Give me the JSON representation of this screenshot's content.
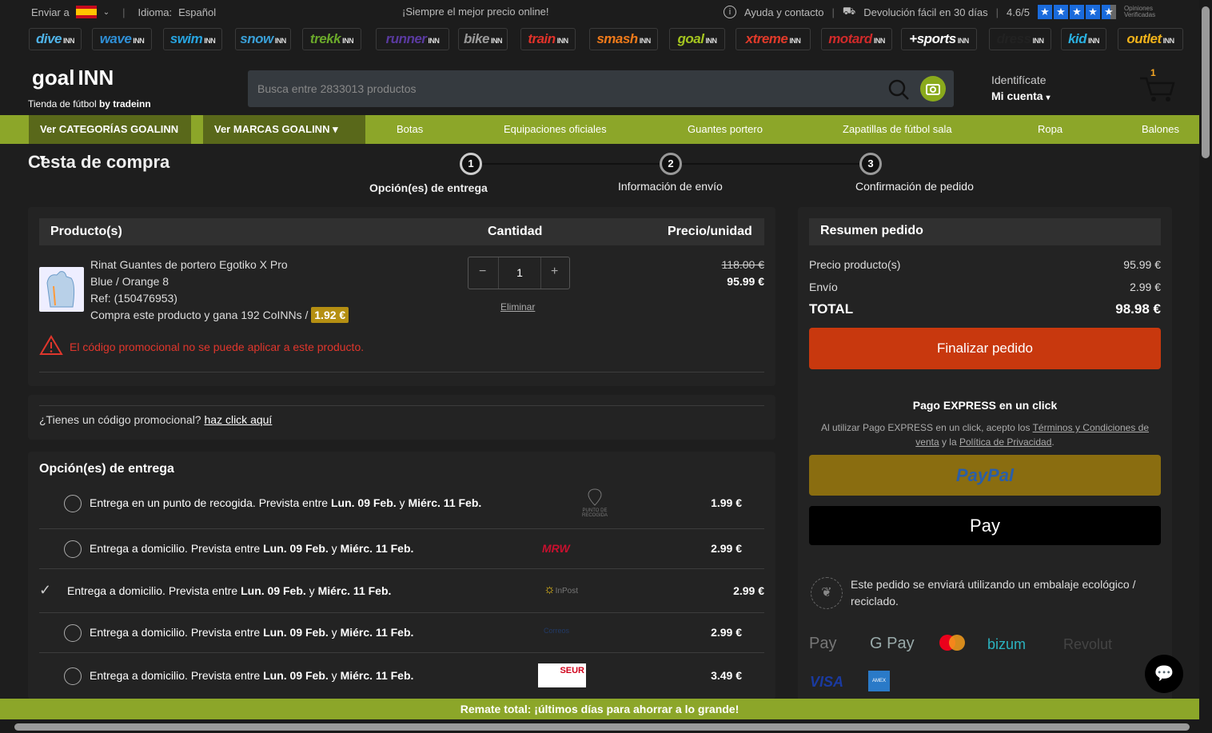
{
  "topbar": {
    "ship_label": "Enviar a",
    "lang_label": "Idioma:",
    "lang_value": "Español",
    "promo": "¡Siempre el mejor precio online!",
    "help": "Ayuda y contacto",
    "returns": "Devolución fácil en 30 días",
    "rating": "4.6/5",
    "verified": "Opiniones Verificadas"
  },
  "brands": [
    {
      "name": "dive",
      "color": "#4fb3e8"
    },
    {
      "name": "wave",
      "color": "#2f8fd6"
    },
    {
      "name": "swim",
      "color": "#27a4e0"
    },
    {
      "name": "snow",
      "color": "#3aa0d8"
    },
    {
      "name": "trekk",
      "color": "#6aa82a"
    },
    {
      "name": "runner",
      "color": "#5a3aa0"
    },
    {
      "name": "bike",
      "color": "#9a9a9a"
    },
    {
      "name": "train",
      "color": "#e0322a"
    },
    {
      "name": "smash",
      "color": "#ef7a1a"
    },
    {
      "name": "goal",
      "color": "#a4c51f"
    },
    {
      "name": "xtreme",
      "color": "#e03a2a"
    },
    {
      "name": "motard",
      "color": "#d02a2a"
    },
    {
      "name": "+sports",
      "color": "#ffffff"
    },
    {
      "name": "dress",
      "color": "#222222"
    },
    {
      "name": "kid",
      "color": "#2ab0e0"
    },
    {
      "name": "outlet",
      "color": "#f0b21a"
    }
  ],
  "brand_suffix": "INN",
  "header": {
    "logo": "goal",
    "logo_suffix": "INN",
    "tagline": "Tienda de fútbol",
    "by": "by tradeinn",
    "search_placeholder": "Busca entre 2833013 productos",
    "login": "Identifícate",
    "account": "Mi cuenta",
    "cart_count": "1"
  },
  "nav": {
    "categories": "Ver CATEGORÍAS GOALINN",
    "brands": "Ver MARCAS GOALINN",
    "links": [
      "Botas",
      "Equipaciones oficiales",
      "Guantes portero",
      "Zapatillas de fútbol sala",
      "Ropa",
      "Balones"
    ]
  },
  "page_title": "Cesta de compra",
  "steps": [
    {
      "num": "1",
      "label": "Opción(es) de entrega"
    },
    {
      "num": "2",
      "label": "Información de envío"
    },
    {
      "num": "3",
      "label": "Confirmación de pedido"
    }
  ],
  "cart": {
    "col_product": "Producto(s)",
    "col_qty": "Cantidad",
    "col_price": "Precio/unidad",
    "product_name": "Rinat Guantes de portero Egotiko X Pro",
    "variant": "Blue / Orange 8",
    "ref": "Ref: (150476953)",
    "coins": "Compra este producto y gana 192 CoINNs /",
    "coins_value": "1.92 €",
    "qty": "1",
    "remove": "Eliminar",
    "old_price": "118.00 €",
    "price": "95.99 €",
    "promo_warning": "El código promocional no se puede aplicar a este producto."
  },
  "promo": {
    "question": "¿Tienes un código promocional?",
    "link": "haz click aquí"
  },
  "delivery": {
    "title": "Opción(es) de entrega",
    "options": [
      {
        "text": "Entrega en un punto de recogida. Prevista entre ",
        "d1": "Lun. 09 Feb.",
        "mid": " y ",
        "d2": "Miérc. 11 Feb.",
        "carrier": "PUNTO DE RECOGIDA",
        "price": "1.99 €"
      },
      {
        "text": "Entrega a domicilio. Prevista entre ",
        "d1": "Lun. 09 Feb.",
        "mid": " y ",
        "d2": "Miérc. 11 Feb.",
        "carrier": "MRW",
        "price": "2.99 €"
      },
      {
        "text": "Entrega a domicilio. Prevista entre ",
        "d1": "Lun. 09 Feb.",
        "mid": " y ",
        "d2": "Miérc. 11 Feb.",
        "carrier": "InPost",
        "price": "2.99 €"
      },
      {
        "text": "Entrega a domicilio. Prevista entre ",
        "d1": "Lun. 09 Feb.",
        "mid": " y ",
        "d2": "Miérc. 11 Feb.",
        "carrier": "Correos",
        "price": "2.99 €"
      },
      {
        "text": "Entrega a domicilio. Prevista entre ",
        "d1": "Lun. 09 Feb.",
        "mid": " y ",
        "d2": "Miérc. 11 Feb.",
        "carrier": "SEUR",
        "price": "3.49 €"
      }
    ]
  },
  "summary": {
    "title": "Resumen pedido",
    "products_label": "Precio producto(s)",
    "products_value": "95.99 €",
    "shipping_label": "Envío",
    "shipping_value": "2.99 €",
    "total_label": "TOTAL",
    "total_value": "98.98 €",
    "checkout": "Finalizar pedido",
    "express_title": "Pago EXPRESS en un click",
    "express_text": "Al utilizar Pago EXPRESS en un click, acepto los ",
    "terms": "Términos y Condiciones de venta",
    "and": " y la ",
    "privacy": "Política de Privacidad",
    "paypal": "PayPal",
    "applepay": "Pay",
    "eco": "Este pedido se enviará utilizando un embalaje ecológico / reciclado.",
    "methods": [
      "Pay",
      "G Pay",
      "bizum",
      "Revolut",
      "VISA",
      "AMEX"
    ]
  },
  "banner": "Remate total: ¡últimos días para ahorrar a lo grande!"
}
